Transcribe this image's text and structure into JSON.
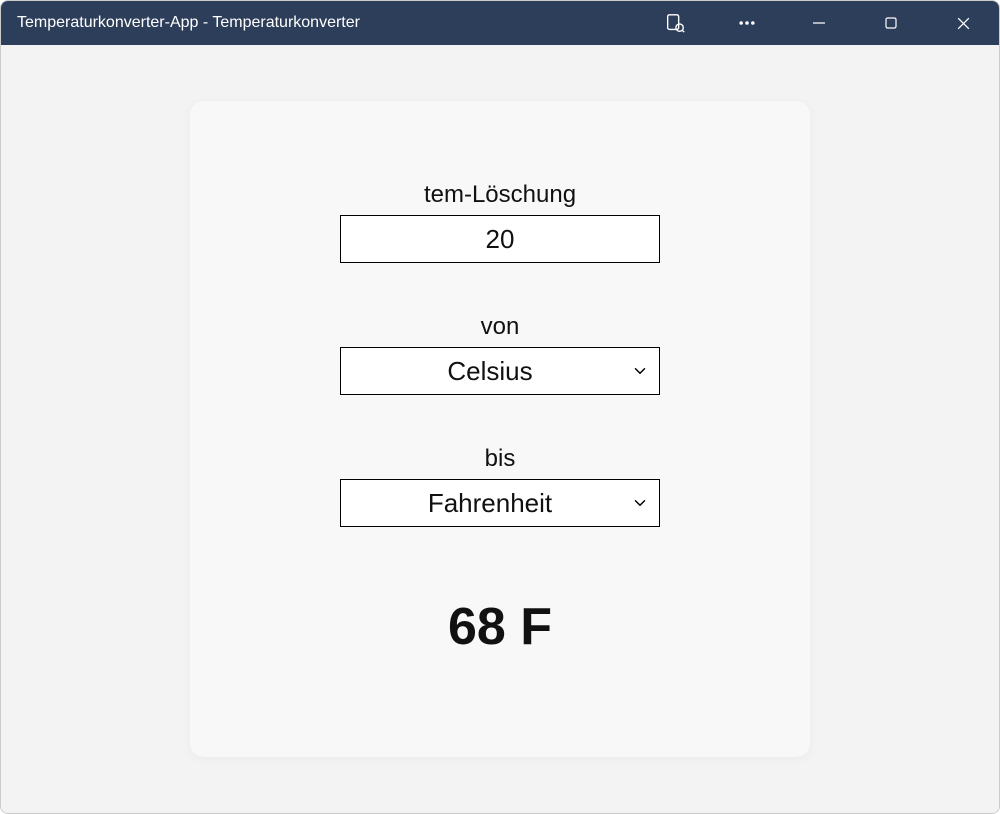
{
  "window": {
    "title": "Temperaturkonverter-App - Temperaturkonverter"
  },
  "form": {
    "temperature_label": "tem-Löschung",
    "temperature_value": "20",
    "from_label": "von",
    "from_value": "Celsius",
    "to_label": "bis",
    "to_value": "Fahrenheit"
  },
  "result": "68 F"
}
